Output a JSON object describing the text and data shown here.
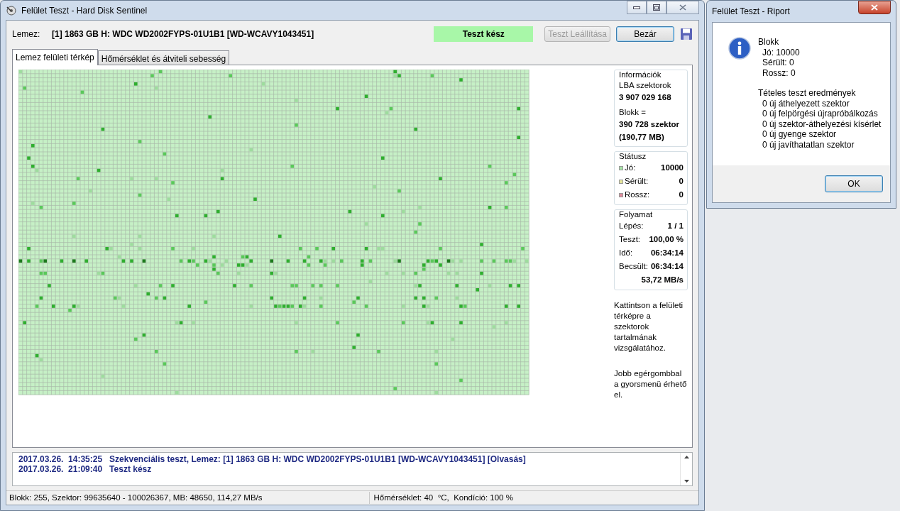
{
  "window": {
    "title": "Felület Teszt - Hard Disk Sentinel"
  },
  "disk": {
    "label": "Lemez:",
    "value": "[1] 1863 GB H: WDC WD2002FYPS-01U1B1 [WD-WCAVY1043451]"
  },
  "status_badge": "Teszt kész",
  "buttons": [
    {
      "label": "Teszt Leállítása",
      "disabled": true
    },
    {
      "label": "Bezár",
      "disabled": false
    }
  ],
  "tabs": [
    {
      "label": "Lemez felületi térkép",
      "selected": true
    },
    {
      "label": "Hőmérséklet és átviteli sebesség",
      "selected": false
    }
  ],
  "info": {
    "title": "Információk",
    "lba_label": "LBA szektorok",
    "lba_value": "3 907 029 168",
    "block_label": "Blokk =",
    "block_value": "390 728 szektor",
    "block_size": "(190,77 MB)"
  },
  "status": {
    "title": "Státusz",
    "rows": [
      {
        "label": "Jó:",
        "value": "10000",
        "color": "#a8e4a8"
      },
      {
        "label": "Sérült:",
        "value": "0",
        "color": "#e4e49a"
      },
      {
        "label": "Rossz:",
        "value": "0",
        "color": "#e08c9c"
      }
    ]
  },
  "progress": {
    "title": "Folyamat",
    "rows": [
      {
        "label": "Lépés:",
        "value": "1 / 1"
      },
      {
        "label": "Teszt:",
        "value": "100,00 %"
      },
      {
        "label": "Idő:",
        "value": "06:34:14"
      },
      {
        "label": "Becsült:",
        "value": "06:34:14"
      }
    ],
    "speed": "53,72 MB/s"
  },
  "hints": [
    "Kattintson a felületi térképre a szektorok tartalmának vizsgálatához.",
    "Jobb egérgombbal a gyorsmenü érhető el."
  ],
  "log": [
    {
      "time": "2017.03.26.  14:35:25",
      "message": "Szekvenciális teszt, Lemez: [1] 1863 GB H: WDC WD2002FYPS-01U1B1 [WD-WCAVY1043451] [Olvasás]"
    },
    {
      "time": "2017.03.26.  21:09:40",
      "message": "Teszt kész"
    }
  ],
  "status_bar": {
    "left": "Blokk: 255, Szektor: 99635640 - 100026367, MB: 48650, 114,27 MB/s",
    "right": "Hőmérséklet: 40  °C,  Kondíció: 100 %"
  },
  "dialog": {
    "title": "Felület Teszt - Riport",
    "lines": [
      {
        "kind": "heading",
        "text": "Blokk"
      },
      {
        "kind": "item",
        "text": "Jó: 10000"
      },
      {
        "kind": "item",
        "text": "Sérült: 0"
      },
      {
        "kind": "item",
        "text": "Rossz: 0"
      },
      {
        "kind": "heading",
        "text": "Tételes teszt eredmények"
      },
      {
        "kind": "item",
        "text": "0 új áthelyezett szektor"
      },
      {
        "kind": "item",
        "text": "0 új felpörgési újrapróbálkozás"
      },
      {
        "kind": "item",
        "text": "0 új szektor-áthelyezési kísérlet"
      },
      {
        "kind": "item",
        "text": "0 új gyenge szektor"
      },
      {
        "kind": "item",
        "text": "0 új javíthatatlan szektor"
      }
    ],
    "ok": "OK"
  }
}
